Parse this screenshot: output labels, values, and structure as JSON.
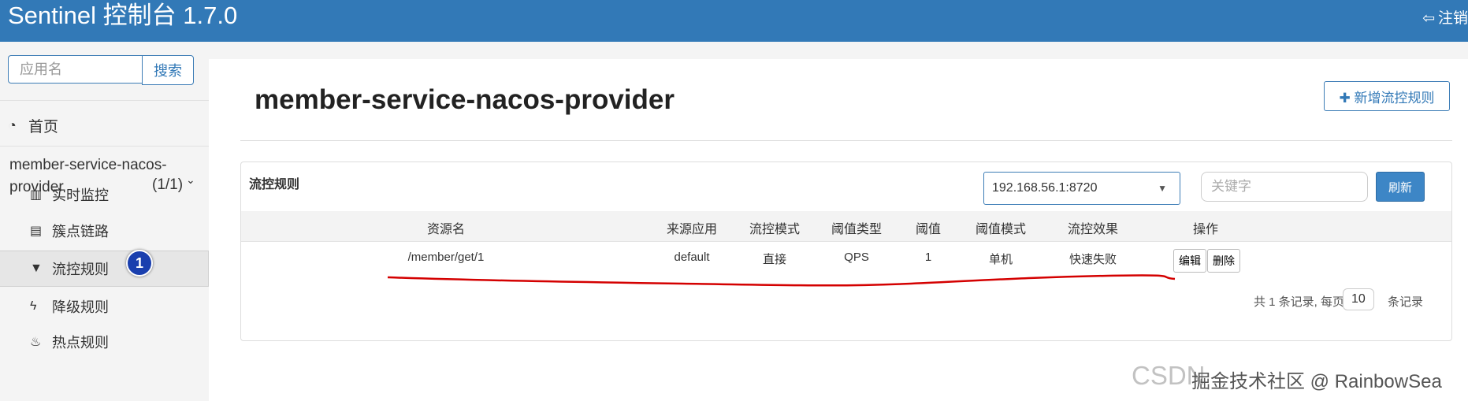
{
  "header": {
    "title": "Sentinel 控制台 1.7.0",
    "logout_label": "注销"
  },
  "sidebar": {
    "search_placeholder": "应用名",
    "search_button": "搜索",
    "home": "首页",
    "app_name": "member-service-nacos-provider",
    "app_count": "(1/1)",
    "items": [
      {
        "label": "实时监控",
        "icon": "bar-chart-icon"
      },
      {
        "label": "簇点链路",
        "icon": "list-icon"
      },
      {
        "label": "流控规则",
        "icon": "filter-icon",
        "active": true
      },
      {
        "label": "降级规则",
        "icon": "bolt-icon"
      },
      {
        "label": "热点规则",
        "icon": "fire-icon"
      }
    ],
    "badge": "1"
  },
  "main": {
    "title": "member-service-nacos-provider",
    "add_button": "新增流控规则",
    "panel_title": "流控规则",
    "machine": "192.168.56.1:8720",
    "keyword_placeholder": "关键字",
    "refresh_button": "刷新",
    "columns": [
      "资源名",
      "来源应用",
      "流控模式",
      "阈值类型",
      "阈值",
      "阈值模式",
      "流控效果",
      "操作"
    ],
    "rows": [
      {
        "resource": "/member/get/1",
        "origin": "default",
        "mode": "直接",
        "grade": "QPS",
        "count": "1",
        "cluster": "单机",
        "effect": "快速失败",
        "edit": "编辑",
        "delete": "删除"
      }
    ],
    "pager": {
      "total_text": "共 1 条记录, 每页",
      "page_size": "10",
      "suffix": "条记录"
    }
  },
  "watermark": {
    "text1": "CSDN",
    "text2": "掘金技术社区 @ RainbowSea"
  },
  "colors": {
    "header": "#3279b7",
    "primary": "#3d86c6",
    "annotation": "#d40000"
  }
}
